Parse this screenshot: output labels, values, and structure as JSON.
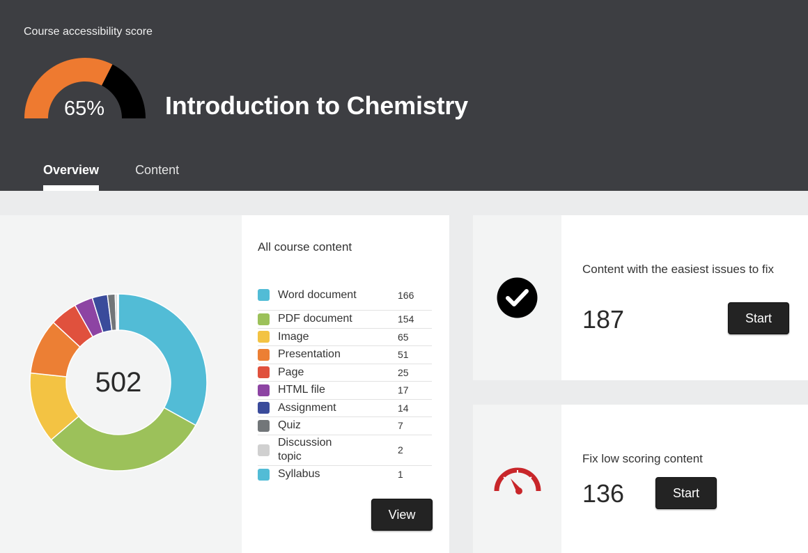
{
  "header": {
    "score_label": "Course accessibility score",
    "score_value": 65,
    "score_text": "65%",
    "course_title": "Introduction to Chemistry",
    "tabs": [
      {
        "label": "Overview",
        "active": true
      },
      {
        "label": "Content",
        "active": false
      }
    ],
    "gauge_colors": {
      "filled": "#ee7a30",
      "remaining": "#000000"
    }
  },
  "content_overview": {
    "title": "All course content",
    "total": "502",
    "view_label": "View",
    "items": [
      {
        "label": "Word document",
        "count": 166,
        "color": "#52bcd6"
      },
      {
        "label": "PDF document",
        "count": 154,
        "color": "#9cc15a"
      },
      {
        "label": "Image",
        "count": 65,
        "color": "#f3c343"
      },
      {
        "label": "Presentation",
        "count": 51,
        "color": "#ec7f34"
      },
      {
        "label": "Page",
        "count": 25,
        "color": "#e0513d"
      },
      {
        "label": "HTML file",
        "count": 17,
        "color": "#8d44a3"
      },
      {
        "label": "Assignment",
        "count": 14,
        "color": "#3a4b9b"
      },
      {
        "label": "Quiz",
        "count": 7,
        "color": "#727679"
      },
      {
        "label": "Discussion topic",
        "count": 2,
        "color": "#d0d0d0"
      },
      {
        "label": "Syllabus",
        "count": 1,
        "color": "#52bcd6"
      }
    ]
  },
  "easy_issues": {
    "title": "Content with the easiest issues to fix",
    "count": "187",
    "button_label": "Start",
    "icon": "check-circle-icon"
  },
  "low_scoring": {
    "title": "Fix low scoring content",
    "count": "136",
    "button_label": "Start",
    "icon": "speedometer-icon",
    "icon_color": "#c8262a"
  }
}
